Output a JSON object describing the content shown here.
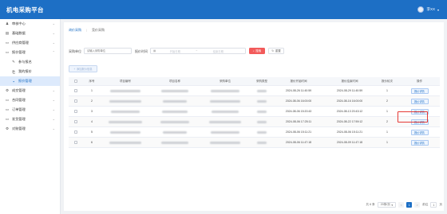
{
  "app": {
    "title": "机电采购平台",
    "user_name": "李XX"
  },
  "sidebar": {
    "items": [
      {
        "label": "审核中心",
        "icon": "user-icon",
        "has_children": true
      },
      {
        "label": "基础数据",
        "icon": "database-icon",
        "has_children": true
      },
      {
        "label": "供应商管理",
        "icon": "doc-icon",
        "has_children": true
      },
      {
        "label": "报价管理",
        "icon": "doc-icon",
        "has_children": true,
        "expanded": true
      },
      {
        "label": "参与报名",
        "icon": "wrench-icon",
        "sub": true
      },
      {
        "label": "我的报价",
        "icon": "list-icon",
        "sub": true
      },
      {
        "label": "报价管理",
        "icon": "square-icon",
        "sub": true,
        "active": true
      },
      {
        "label": "成交管理",
        "icon": "gear-icon",
        "has_children": true
      },
      {
        "label": "合同管理",
        "icon": "doc-icon",
        "has_children": true
      },
      {
        "label": "订单管理",
        "icon": "doc-icon",
        "has_children": true
      },
      {
        "label": "发货管理",
        "icon": "doc-icon",
        "has_children": true
      },
      {
        "label": "对账管理",
        "icon": "gear-icon",
        "has_children": true
      }
    ]
  },
  "tabs": [
    {
      "label": "询价采购",
      "active": true
    },
    {
      "label": "竞价采购",
      "active": false
    }
  ],
  "filters": {
    "unit_label": "采购单位",
    "unit_placeholder": "请输入采购单位",
    "time_label": "报价时间",
    "start_placeholder": "开始日期",
    "range_sep": "~",
    "end_placeholder": "结束日期",
    "search_label": "搜索",
    "reset_label": "重置"
  },
  "actions": {
    "add_label": "添加报价信息"
  },
  "table": {
    "columns": [
      "序号",
      "项目编号",
      "项目名称",
      "采购单位",
      "采购类型",
      "报价开始时间",
      "报价结束时间",
      "报价轮次",
      "操作"
    ],
    "rows": [
      {
        "no": "1",
        "start": "2024-08-26 11:40:59",
        "end": "2024-08-29 11:40:59",
        "round": "1",
        "op": "报价详情"
      },
      {
        "no": "2",
        "start": "2024-08-06 16:00:00",
        "end": "2024-08-16 16:00:00",
        "round": "2",
        "op": "报价详情"
      },
      {
        "no": "3",
        "start": "2024-08-06 15:20:43",
        "end": "2024-08-13 20:43:12",
        "round": "1",
        "op": "报价详情"
      },
      {
        "no": "4",
        "start": "2024-08-06 17:25:11",
        "end": "2024-08-22 17:59:12",
        "round": "2",
        "op": "报价详情"
      },
      {
        "no": "5",
        "start": "2024-08-06 15:11:21",
        "end": "2024-08-06 15:11:21",
        "round": "1",
        "op": "报价详情"
      },
      {
        "no": "6",
        "start": "2024-08-06 11:47:18",
        "end": "2024-08-09 11:47:18",
        "round": "1",
        "op": "报价详情"
      }
    ]
  },
  "pagination": {
    "total_label": "共 6 条",
    "page_size": "20条/页",
    "prev": "<",
    "current": "1",
    "next": ">",
    "goto_prefix": "前往",
    "goto_value": "1",
    "goto_suffix": "页"
  },
  "colors": {
    "primary": "#1d6fc5",
    "search": "#f25a5a",
    "highlight": "#e53935"
  }
}
